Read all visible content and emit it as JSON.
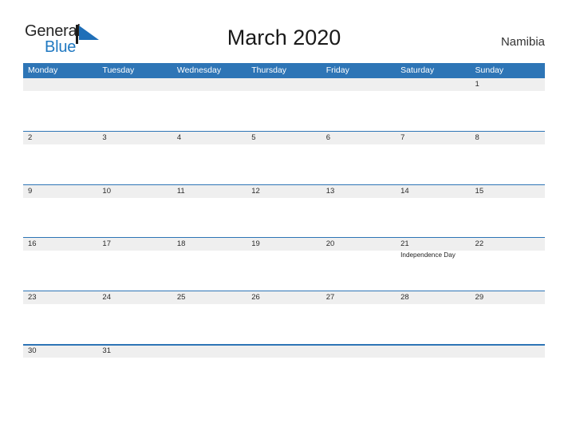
{
  "logo": {
    "word_one": "General",
    "word_two": "Blue",
    "flag_icon": "blue-triangle-flag-icon",
    "word_one_color": "#262626",
    "word_two_color": "#1f78c1",
    "flag_color": "#1f6fb8"
  },
  "header": {
    "title": "March 2020",
    "region": "Namibia"
  },
  "theme": {
    "header_blue": "#2e75b6",
    "row_line_blue": "#2e75b6",
    "day_band_gray": "#efefef",
    "page_background": "#ffffff",
    "title_color": "#1a1a1a"
  },
  "calendar": {
    "month": "March",
    "year": "2020",
    "weekday_headers": [
      "Monday",
      "Tuesday",
      "Wednesday",
      "Thursday",
      "Friday",
      "Saturday",
      "Sunday"
    ],
    "weeks": [
      {
        "days": [
          {
            "number": "",
            "event": ""
          },
          {
            "number": "",
            "event": ""
          },
          {
            "number": "",
            "event": ""
          },
          {
            "number": "",
            "event": ""
          },
          {
            "number": "",
            "event": ""
          },
          {
            "number": "",
            "event": ""
          },
          {
            "number": "1",
            "event": ""
          }
        ]
      },
      {
        "days": [
          {
            "number": "2",
            "event": ""
          },
          {
            "number": "3",
            "event": ""
          },
          {
            "number": "4",
            "event": ""
          },
          {
            "number": "5",
            "event": ""
          },
          {
            "number": "6",
            "event": ""
          },
          {
            "number": "7",
            "event": ""
          },
          {
            "number": "8",
            "event": ""
          }
        ]
      },
      {
        "days": [
          {
            "number": "9",
            "event": ""
          },
          {
            "number": "10",
            "event": ""
          },
          {
            "number": "11",
            "event": ""
          },
          {
            "number": "12",
            "event": ""
          },
          {
            "number": "13",
            "event": ""
          },
          {
            "number": "14",
            "event": ""
          },
          {
            "number": "15",
            "event": ""
          }
        ]
      },
      {
        "days": [
          {
            "number": "16",
            "event": ""
          },
          {
            "number": "17",
            "event": ""
          },
          {
            "number": "18",
            "event": ""
          },
          {
            "number": "19",
            "event": ""
          },
          {
            "number": "20",
            "event": ""
          },
          {
            "number": "21",
            "event": "Independence Day"
          },
          {
            "number": "22",
            "event": ""
          }
        ]
      },
      {
        "days": [
          {
            "number": "23",
            "event": ""
          },
          {
            "number": "24",
            "event": ""
          },
          {
            "number": "25",
            "event": ""
          },
          {
            "number": "26",
            "event": ""
          },
          {
            "number": "27",
            "event": ""
          },
          {
            "number": "28",
            "event": ""
          },
          {
            "number": "29",
            "event": ""
          }
        ]
      },
      {
        "days": [
          {
            "number": "30",
            "event": ""
          },
          {
            "number": "31",
            "event": ""
          },
          {
            "number": "",
            "event": ""
          },
          {
            "number": "",
            "event": ""
          },
          {
            "number": "",
            "event": ""
          },
          {
            "number": "",
            "event": ""
          },
          {
            "number": "",
            "event": ""
          }
        ]
      }
    ]
  }
}
